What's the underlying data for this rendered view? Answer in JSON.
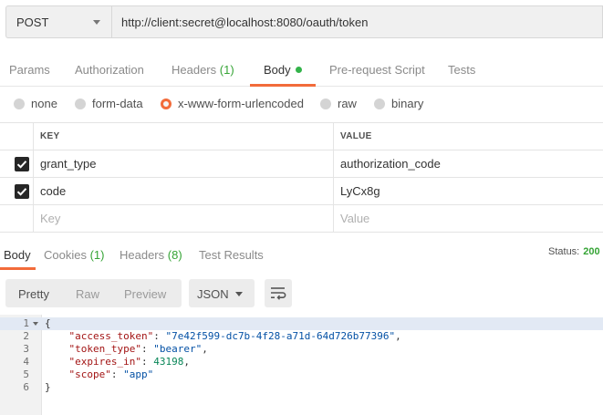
{
  "request": {
    "method": "POST",
    "url": "http://client:secret@localhost:8080/oauth/token"
  },
  "request_tabs": [
    {
      "label": "Params",
      "count": ""
    },
    {
      "label": "Authorization",
      "count": ""
    },
    {
      "label": "Headers",
      "count": "(1)"
    },
    {
      "label": "Body",
      "count": ""
    },
    {
      "label": "Pre-request Script",
      "count": ""
    },
    {
      "label": "Tests",
      "count": ""
    }
  ],
  "active_request_tab": "Body",
  "body_types": [
    "none",
    "form-data",
    "x-www-form-urlencoded",
    "raw",
    "binary"
  ],
  "selected_body_type": "x-www-form-urlencoded",
  "params_table": {
    "headers": {
      "key": "KEY",
      "value": "VALUE"
    },
    "rows": [
      {
        "key": "grant_type",
        "value": "authorization_code",
        "checked": true
      },
      {
        "key": "code",
        "value": "LyCx8g",
        "checked": true
      }
    ],
    "placeholder": {
      "key": "Key",
      "value": "Value"
    }
  },
  "response_tabs": [
    {
      "label": "Body",
      "count": ""
    },
    {
      "label": "Cookies",
      "count": "(1)"
    },
    {
      "label": "Headers",
      "count": "(8)"
    },
    {
      "label": "Test Results",
      "count": ""
    }
  ],
  "active_response_tab": "Body",
  "status": {
    "label": "Status:",
    "code": "200"
  },
  "view_modes": [
    "Pretty",
    "Raw",
    "Preview"
  ],
  "active_view_mode": "Pretty",
  "format": "JSON",
  "response_json": {
    "line_numbers": [
      "1",
      "2",
      "3",
      "4",
      "5",
      "6"
    ],
    "open_brace": "{",
    "close_brace": "}",
    "fields": [
      {
        "key": "\"access_token\"",
        "value": "\"7e42f599-dc7b-4f28-a71d-64d726b77396\"",
        "type": "string"
      },
      {
        "key": "\"token_type\"",
        "value": "\"bearer\"",
        "type": "string"
      },
      {
        "key": "\"expires_in\"",
        "value": "43198",
        "type": "number"
      },
      {
        "key": "\"scope\"",
        "value": "\"app\"",
        "type": "string"
      }
    ]
  },
  "colors": {
    "accent": "#f26b3a",
    "count_green": "#36a436",
    "dot_green": "#33b34a"
  },
  "icons": {
    "method_dropdown": "chevron-down-icon",
    "checkbox": "checkmark-icon",
    "wrap": "wrap-lines-icon",
    "fold": "fold-caret-icon"
  }
}
